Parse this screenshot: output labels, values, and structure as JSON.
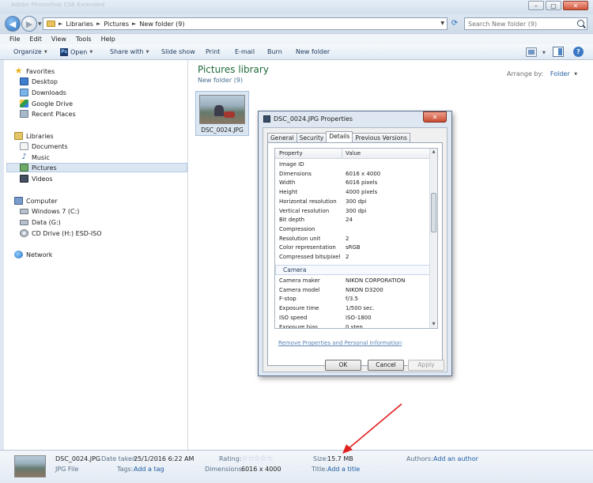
{
  "window": {
    "title_ghost": "Adobe Photoshop CS6 Extended",
    "minimize_glyph": "–",
    "maximize_glyph": "▢",
    "close_glyph": "✕"
  },
  "address": {
    "breadcrumbs": [
      "Libraries",
      "Pictures",
      "New folder (9)"
    ],
    "separator": "►",
    "search_placeholder": "Search New folder (9)"
  },
  "menu": [
    "File",
    "Edit",
    "View",
    "Tools",
    "Help"
  ],
  "toolbar": {
    "organize": "Organize",
    "open": "Open",
    "share_with": "Share with",
    "slide_show": "Slide show",
    "print": "Print",
    "email": "E-mail",
    "burn": "Burn",
    "new_folder": "New folder",
    "open_app_icon_text": "Ps",
    "help_glyph": "?"
  },
  "nav": {
    "favorites": "Favorites",
    "desktop": "Desktop",
    "downloads": "Downloads",
    "google_drive": "Google Drive",
    "recent_places": "Recent Places",
    "libraries": "Libraries",
    "documents": "Documents",
    "music": "Music",
    "pictures": "Pictures",
    "videos": "Videos",
    "computer": "Computer",
    "windows7": "Windows 7 (C:)",
    "data": "Data (G:)",
    "cd_drive": "CD Drive (H:) ESD-ISO",
    "network": "Network"
  },
  "content": {
    "library_title": "Pictures library",
    "library_sub": "New folder (9)",
    "arrange_label": "Arrange by:",
    "arrange_value": "Folder",
    "file_name": "DSC_0024.JPG"
  },
  "dialog": {
    "title": "DSC_0024.JPG Properties",
    "tabs": [
      "General",
      "Security",
      "Details",
      "Previous Versions"
    ],
    "col_property": "Property",
    "col_value": "Value",
    "rows_image": [
      {
        "k": "Image ID",
        "v": ""
      },
      {
        "k": "Dimensions",
        "v": "6016 x 4000"
      },
      {
        "k": "Width",
        "v": "6016 pixels"
      },
      {
        "k": "Height",
        "v": "4000 pixels"
      },
      {
        "k": "Horizontal resolution",
        "v": "300 dpi"
      },
      {
        "k": "Vertical resolution",
        "v": "300 dpi"
      },
      {
        "k": "Bit depth",
        "v": "24"
      },
      {
        "k": "Compression",
        "v": ""
      },
      {
        "k": "Resolution unit",
        "v": "2"
      },
      {
        "k": "Color representation",
        "v": "sRGB"
      },
      {
        "k": "Compressed bits/pixel",
        "v": "2"
      }
    ],
    "section_camera": "Camera",
    "rows_camera": [
      {
        "k": "Camera maker",
        "v": "NIKON CORPORATION"
      },
      {
        "k": "Camera model",
        "v": "NIKON D3200"
      },
      {
        "k": "F-stop",
        "v": "f/3.5"
      },
      {
        "k": "Exposure time",
        "v": "1/500 sec."
      },
      {
        "k": "ISO speed",
        "v": "ISO-1800"
      },
      {
        "k": "Exposure bias",
        "v": "0 step"
      }
    ],
    "remove_link": "Remove Properties and Personal Information",
    "ok": "OK",
    "cancel": "Cancel",
    "apply": "Apply"
  },
  "details": {
    "file_name": "DSC_0024.JPG",
    "date_taken_label": "Date taken:",
    "date_taken": "25/1/2016 6:22 AM",
    "file_type": "JPG File",
    "tags_label": "Tags:",
    "tags_value": "Add a tag",
    "rating_label": "Rating:",
    "rating_value": 0,
    "rating_stars": "☆☆☆☆☆",
    "dimensions_label": "Dimensions:",
    "dimensions": "6016 x 4000",
    "size_label": "Size:",
    "size": "15.7 MB",
    "title_label": "Title:",
    "title_value": "Add a title",
    "authors_label": "Authors:",
    "authors_value": "Add an author"
  },
  "colors": {
    "library_title": "#1e6a39",
    "link": "#1f5ba3",
    "annotation_arrow": "#e02020"
  }
}
